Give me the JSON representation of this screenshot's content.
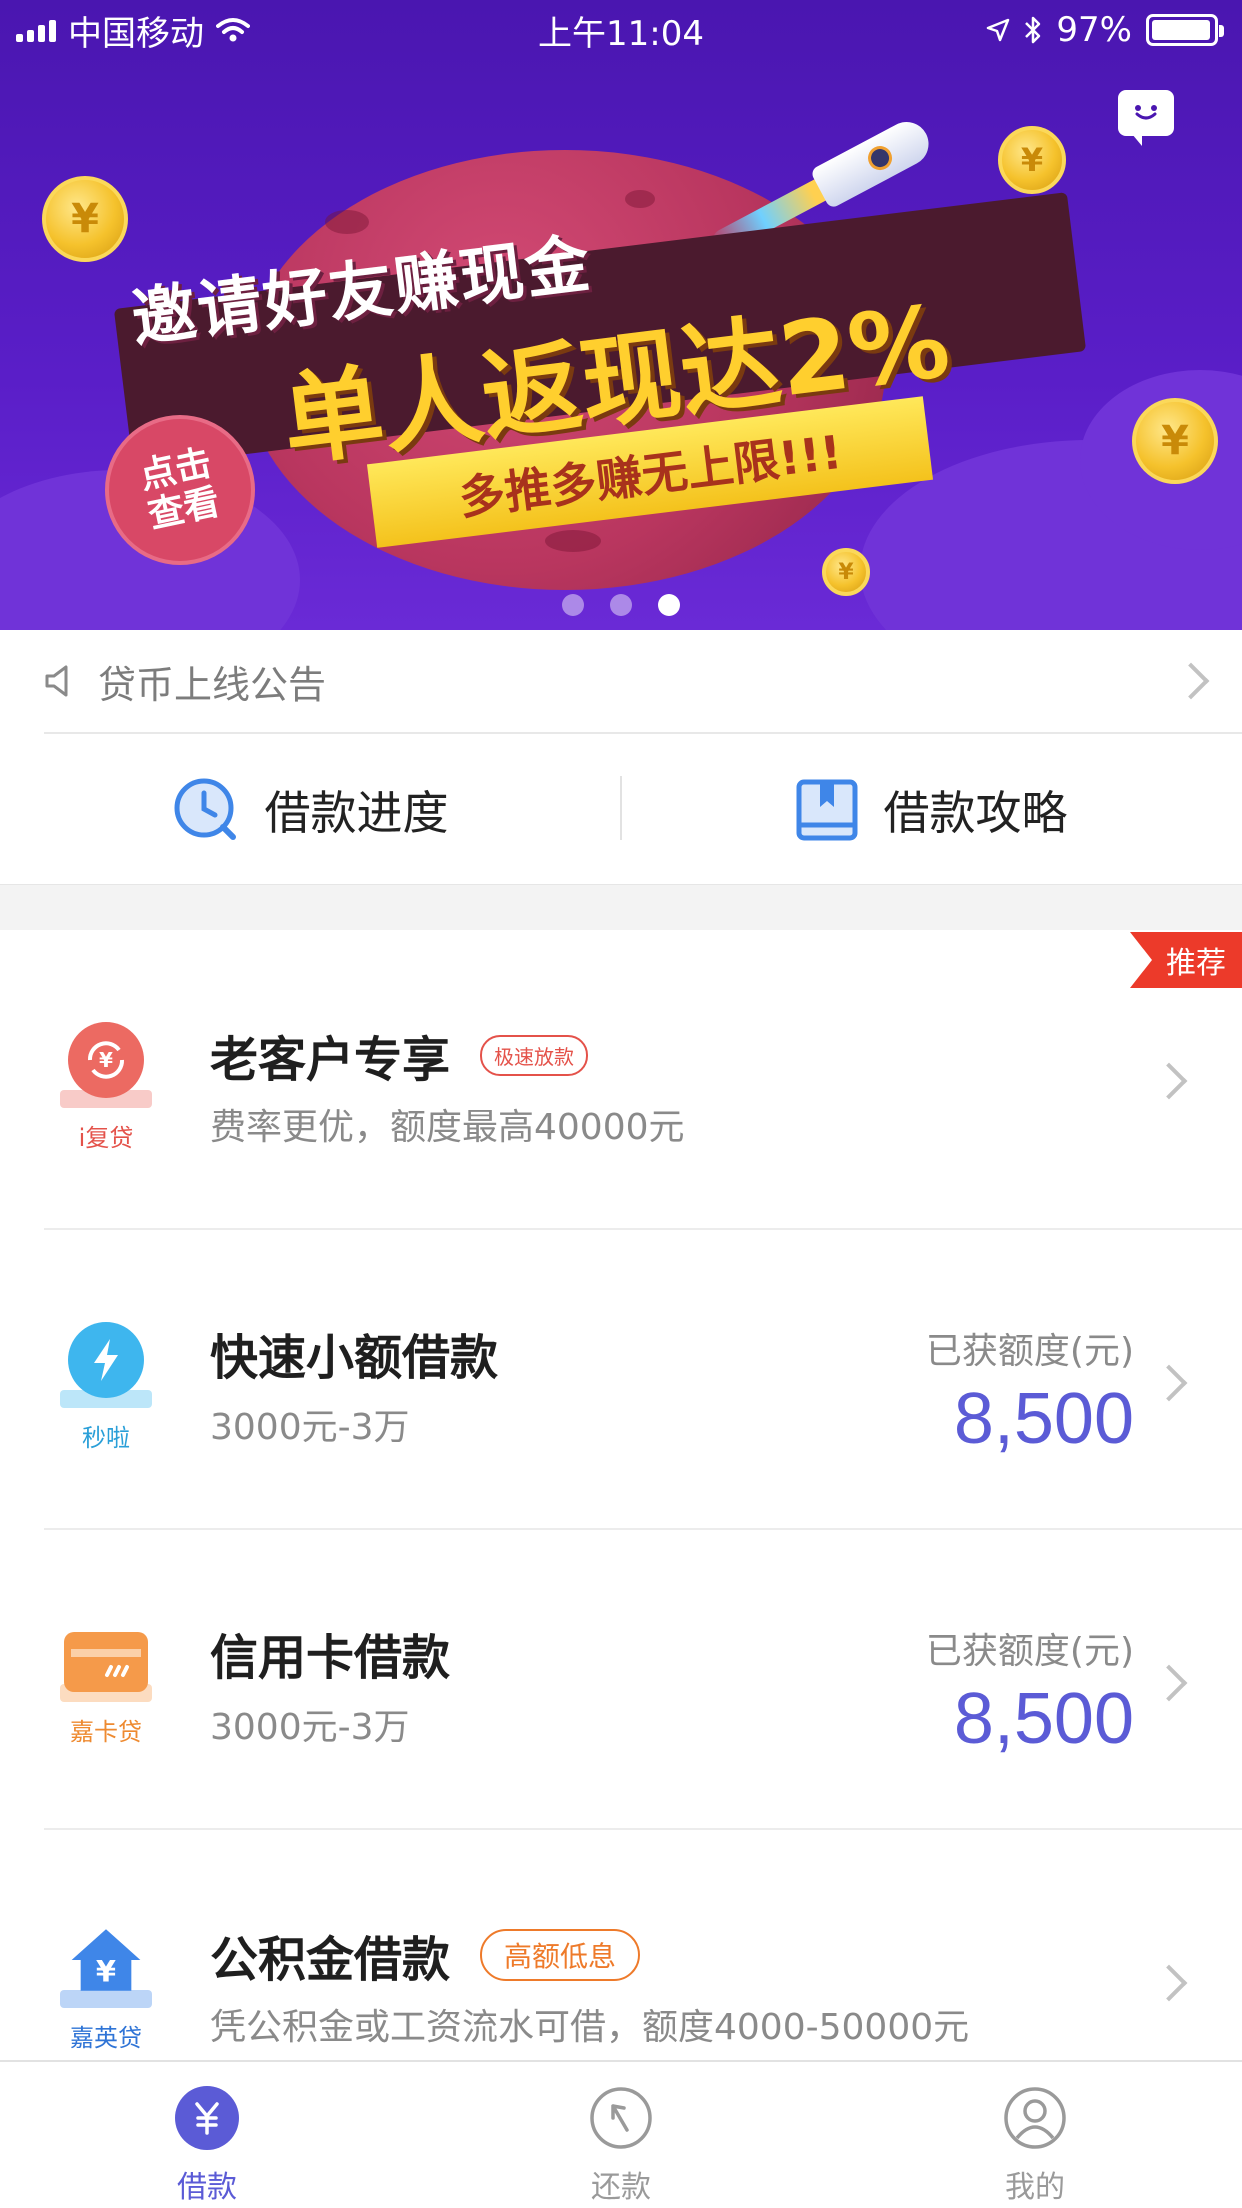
{
  "status_bar": {
    "carrier": "中国移动",
    "time": "上午11:04",
    "battery_percent": "97%",
    "battery_level": 0.97
  },
  "banner": {
    "headline_line1": "邀请好友赚现金",
    "headline_line2": "单人返现达2%",
    "ribbon_text": "多推多赚无上限!!!",
    "badge_text": "点击查看",
    "carousel_total": 3,
    "carousel_active_index": 2
  },
  "notice": {
    "text": "贷币上线公告"
  },
  "quick_links": [
    {
      "label": "借款进度",
      "icon": "clock-icon"
    },
    {
      "label": "借款攻略",
      "icon": "book-icon"
    }
  ],
  "products": {
    "recommend_badge": "推荐",
    "items": [
      {
        "title": "老客户专享",
        "tag": "极速放款",
        "subtitle": "费率更优，额度最高40000元",
        "brand": "i复贷",
        "icon": "refresh-yuan-icon",
        "color": "#ec6a62"
      },
      {
        "title": "快速小额借款",
        "subtitle": "3000元-3万",
        "brand": "秒啦",
        "icon": "lightning-icon",
        "color": "#3eb6ee",
        "quota_label": "已获额度(元)",
        "quota_value": "8,500"
      },
      {
        "title": "信用卡借款",
        "subtitle": "3000元-3万",
        "brand": "嘉卡贷",
        "icon": "credit-card-icon",
        "color": "#f59a4a",
        "quota_label": "已获额度(元)",
        "quota_value": "8,500"
      },
      {
        "title": "公积金借款",
        "tag": "高额低息",
        "subtitle": "凭公积金或工资流水可借，额度4000-50000元",
        "brand": "嘉英贷",
        "icon": "house-yuan-icon",
        "color": "#3f86e8"
      }
    ]
  },
  "tabbar": {
    "items": [
      {
        "label": "借款",
        "icon": "yuan-icon",
        "active": true
      },
      {
        "label": "还款",
        "icon": "return-icon",
        "active": false
      },
      {
        "label": "我的",
        "icon": "user-icon",
        "active": false
      }
    ],
    "active_color": "#5b5bd6",
    "inactive_color": "#9a9a9a"
  }
}
